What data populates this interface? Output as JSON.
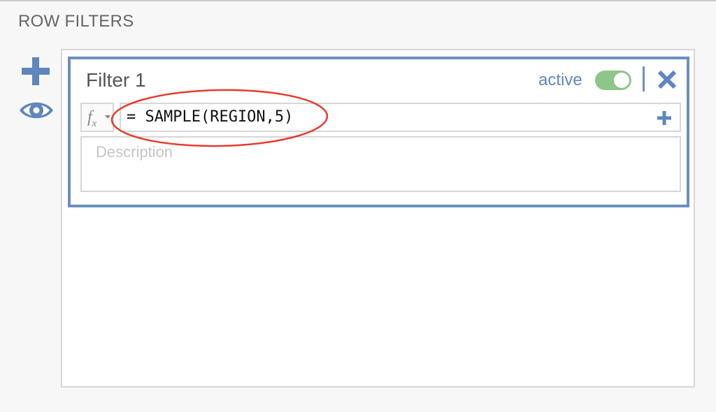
{
  "section": {
    "title": "ROW FILTERS"
  },
  "actions": {
    "add_icon": "plus-icon",
    "preview_icon": "eye-icon"
  },
  "filter": {
    "name": "Filter 1",
    "status_label": "active",
    "active": true,
    "close_icon": "close-icon",
    "function_icon": "fx-icon",
    "formula": "= SAMPLE(REGION,5)",
    "add_icon": "plus-icon",
    "description": {
      "value": "",
      "placeholder": "Description"
    }
  },
  "colors": {
    "accent": "#5f86bd",
    "toggle_on": "#8dc68a",
    "annotation": "#e63b2e",
    "border": "#d6d6d6",
    "background": "#f7f7f7"
  }
}
